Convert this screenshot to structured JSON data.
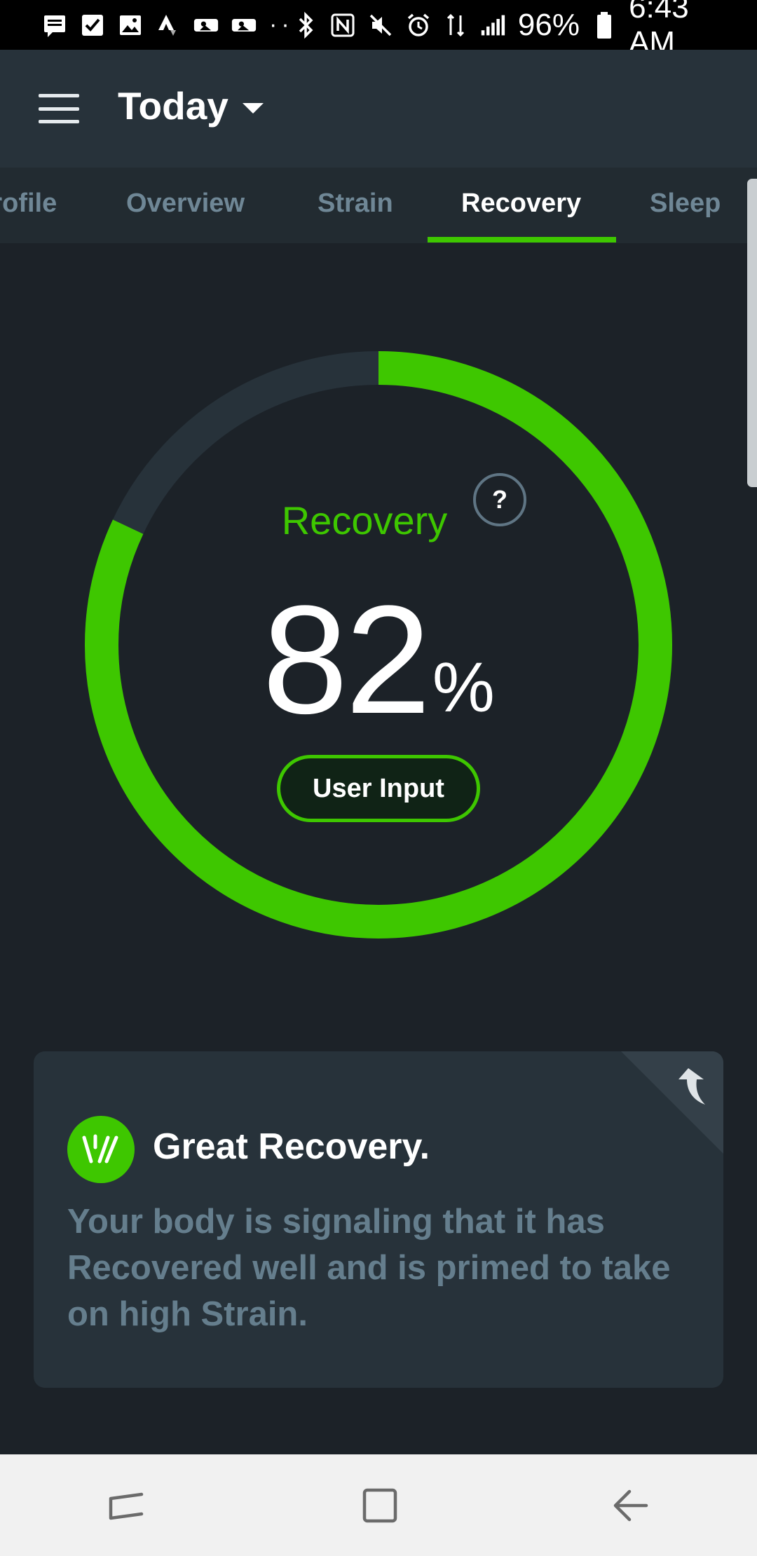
{
  "status_bar": {
    "battery": "96%",
    "time": "6:43 AM"
  },
  "header": {
    "title": "Today"
  },
  "tabs": [
    {
      "label": "Profile"
    },
    {
      "label": "Overview"
    },
    {
      "label": "Strain"
    },
    {
      "label": "Recovery",
      "active": true
    },
    {
      "label": "Sleep"
    }
  ],
  "recovery": {
    "label": "Recovery",
    "help": "?",
    "value": "82",
    "unit": "%",
    "score_fraction": 0.82,
    "user_input_label": "User Input"
  },
  "insight": {
    "title": "Great Recovery.",
    "body": "Your body is signaling that it has Recovered well and is primed to take on high Strain."
  },
  "colors": {
    "accent_green": "#3ec700",
    "background": "#1c2228",
    "header": "#27323a",
    "muted_text": "#657e8d"
  }
}
